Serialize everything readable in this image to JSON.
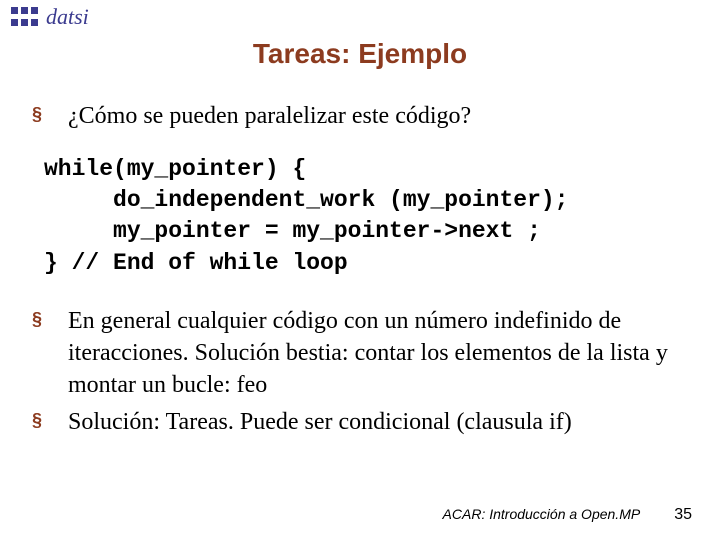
{
  "logo": {
    "text": "datsi"
  },
  "title": "Tareas: Ejemplo",
  "bullets": [
    {
      "text": "¿Cómo se pueden paralelizar este código?"
    },
    {
      "text": "En general cualquier código con un número indefinido de iteracciones. Solución bestia: contar los elementos de la lista y montar un bucle: feo"
    },
    {
      "text": "Solución: Tareas. Puede ser condicional (clausula if)"
    }
  ],
  "code": "while(my_pointer) {\n     do_independent_work (my_pointer);\n     my_pointer = my_pointer->next ;\n} // End of while loop",
  "footer": {
    "text": "ACAR: Introducción a Open.MP",
    "page": "35"
  }
}
